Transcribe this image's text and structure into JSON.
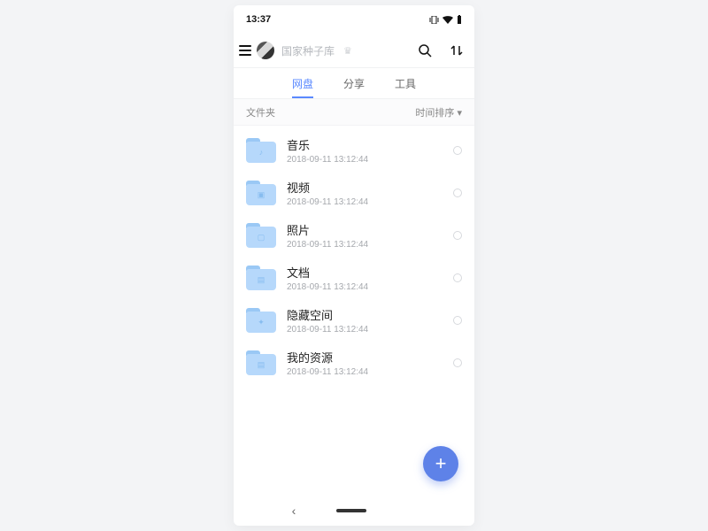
{
  "status": {
    "time": "13:37"
  },
  "user": {
    "name": "国家种子库"
  },
  "tabs": {
    "items": [
      "网盘",
      "分享",
      "工具"
    ],
    "active": 0
  },
  "section": {
    "label": "文件夹",
    "sort": "时间排序 ▾"
  },
  "folders": [
    {
      "name": "音乐",
      "date": "2018-09-11 13:12:44",
      "glyph": "♪"
    },
    {
      "name": "视频",
      "date": "2018-09-11 13:12:44",
      "glyph": "▣"
    },
    {
      "name": "照片",
      "date": "2018-09-11 13:12:44",
      "glyph": "▢"
    },
    {
      "name": "文档",
      "date": "2018-09-11 13:12:44",
      "glyph": "▤"
    },
    {
      "name": "隐藏空间",
      "date": "2018-09-11 13:12:44",
      "glyph": "✦"
    },
    {
      "name": "我的资源",
      "date": "2018-09-11 13:12:44",
      "glyph": "▤"
    }
  ],
  "fab": {
    "label": "+"
  }
}
